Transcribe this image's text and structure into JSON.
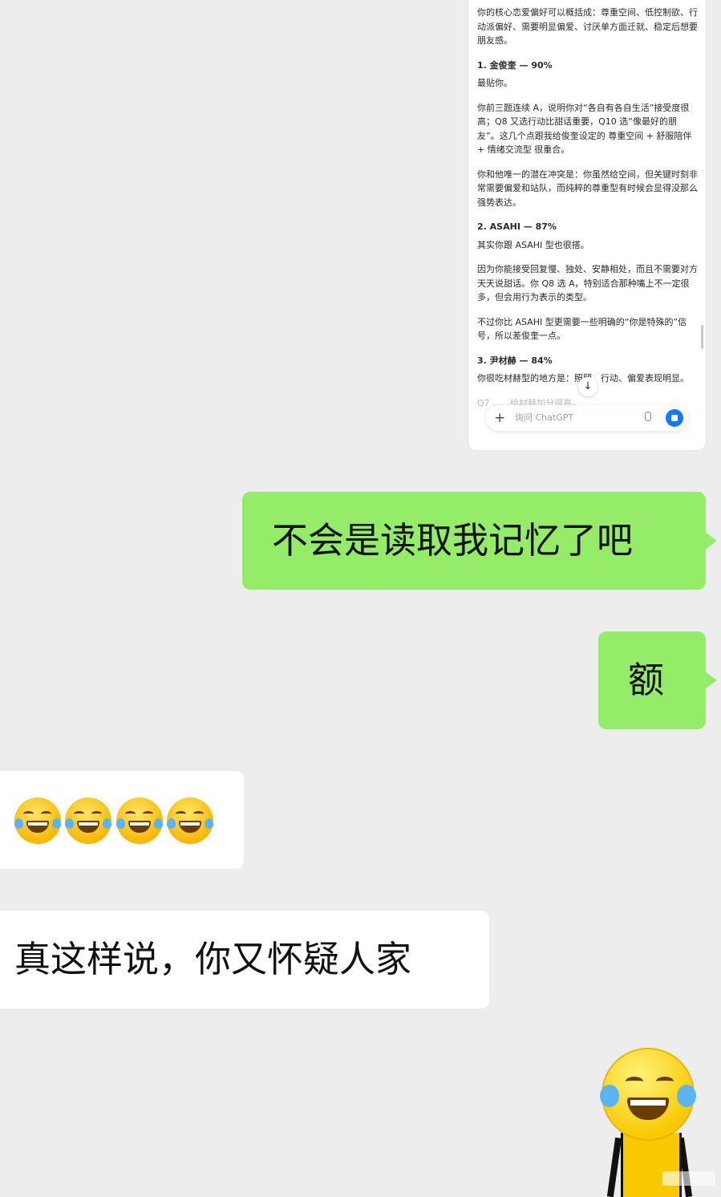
{
  "chat": {
    "screenshot_bubble": {
      "paragraphs": [
        "你的核心恋爱偏好可以概括成：尊重空间、低控制欲、行动派偏好、需要明显偏爱、讨厌单方面迁就、稳定后想要朋友感。",
        "1. 金俊奎 — 90%",
        "最贴你。",
        "你前三题连续 A，说明你对“各自有各自生活”接受度很高；Q8 又选行动比甜话重要，Q10 选“像最好的朋友”。这几个点跟我给俊奎设定的 尊重空间 + 舒服陪伴 + 情绪交流型 很重合。",
        "你和他唯一的潜在冲突是：你虽然给空间，但关键时刻非常需要偏爱和站队，而纯粹的尊重型有时候会显得没那么强势表达。",
        "2. ASAHI — 87%",
        "其实你跟 ASAHI 型也很搭。",
        "因为你能接受回复慢、独处、安静相处，而且不需要对方天天说甜话。你 Q8 选 A，特别适合那种嘴上不一定很多，但会用行为表示的类型。",
        "不过你比 ASAHI 型更需要一些明确的“你是特殊的”信号，所以差俊奎一点。",
        "3. 尹材赫 — 84%",
        "你很吃材赫型的地方是：照顾、行动、偏爱表现明显。",
        "Q7 ……给材赫加分很高。"
      ],
      "composer_placeholder": "询问 ChatGPT",
      "scroll_down_icon": "↓",
      "plus_icon": "+"
    },
    "messages": [
      {
        "side": "right",
        "text": "不会是读取我记忆了吧"
      },
      {
        "side": "right",
        "text": "额"
      },
      {
        "side": "left",
        "emoji": [
          "face-with-tears-of-joy",
          "face-with-tears-of-joy",
          "face-with-tears-of-joy",
          "face-with-tears-of-joy"
        ]
      },
      {
        "side": "left",
        "text": "真这样说，你又怀疑人家"
      }
    ],
    "sticker": "crying-laughing-sticker"
  },
  "colors": {
    "background": "#ededed",
    "my_bubble": "#95ec69",
    "their_bubble": "#ffffff",
    "send_button": "#1677ff"
  }
}
